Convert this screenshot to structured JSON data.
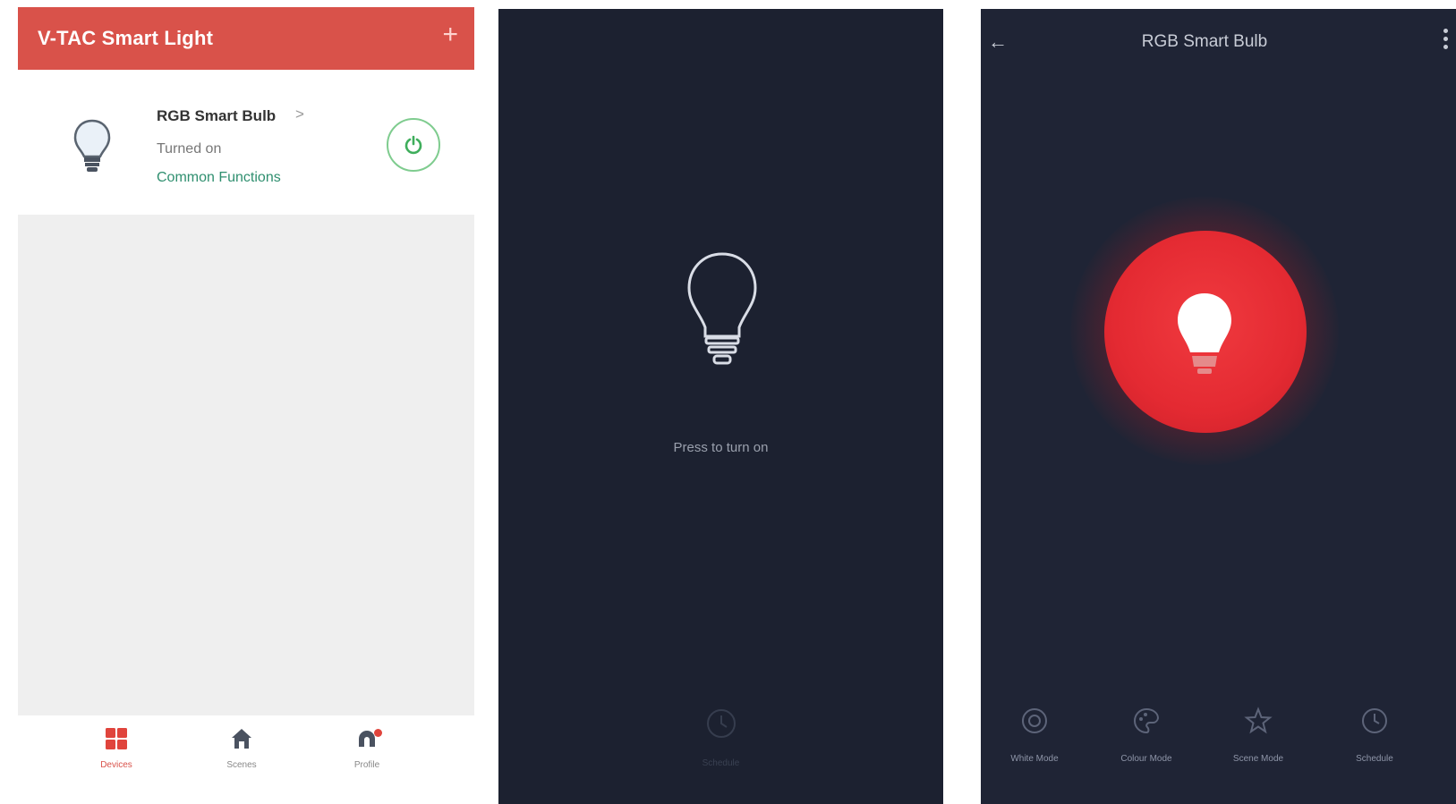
{
  "panel1": {
    "app_title": "V-TAC Smart Light",
    "add_icon": "plus-icon",
    "device": {
      "name": "RGB Smart Bulb",
      "chevron": ">",
      "status": "Turned on",
      "functions_link": "Common Functions"
    },
    "bottom_nav": [
      {
        "label": "Devices",
        "icon": "devices-grid-icon"
      },
      {
        "label": "Scenes",
        "icon": "home-icon"
      },
      {
        "label": "Profile",
        "icon": "profile-icon"
      }
    ],
    "colors": {
      "brand": "#d9524a",
      "power_ring": "#7fcc8f",
      "link": "#2f8f6f"
    }
  },
  "panel2": {
    "prompt": "Press to turn on",
    "schedule_label": "Schedule"
  },
  "panel3": {
    "title": "RGB Smart Bulb",
    "back_icon": "back-arrow-icon",
    "more_icon": "more-vertical-icon",
    "modes": [
      {
        "label": "White Mode",
        "icon": "white-mode-icon"
      },
      {
        "label": "Colour Mode",
        "icon": "colour-mode-icon"
      },
      {
        "label": "Scene Mode",
        "icon": "scene-mode-icon"
      },
      {
        "label": "Schedule",
        "icon": "schedule-icon"
      }
    ],
    "colors": {
      "bulb_glow": "#e42a32",
      "background": "#1f2435"
    }
  }
}
